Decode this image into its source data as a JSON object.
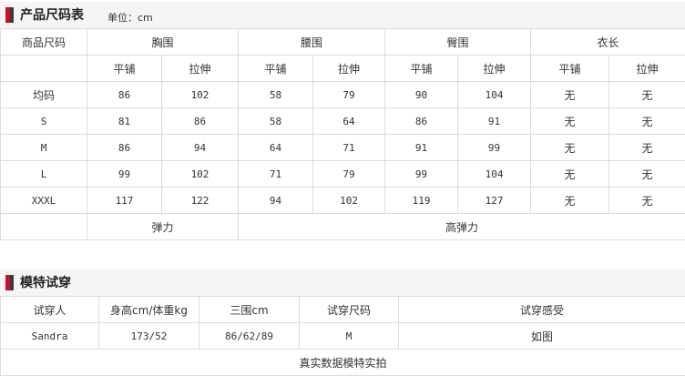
{
  "size_chart": {
    "title": "产品尺码表",
    "unit": "单位：cm",
    "header_main": [
      "商品尺码",
      "胸围",
      "腰围",
      "臀围",
      "衣长"
    ],
    "header_sub": [
      "平铺",
      "拉伸",
      "平铺",
      "拉伸",
      "平铺",
      "拉伸",
      "平铺",
      "拉伸"
    ],
    "rows": [
      {
        "size": "均码",
        "values": [
          "86",
          "102",
          "58",
          "79",
          "90",
          "104",
          "无",
          "无"
        ]
      },
      {
        "size": "S",
        "values": [
          "81",
          "86",
          "58",
          "64",
          "86",
          "91",
          "无",
          "无"
        ]
      },
      {
        "size": "M",
        "values": [
          "86",
          "94",
          "64",
          "71",
          "91",
          "99",
          "无",
          "无"
        ]
      },
      {
        "size": "L",
        "values": [
          "99",
          "102",
          "71",
          "79",
          "99",
          "104",
          "无",
          "无"
        ]
      },
      {
        "size": "XXXL",
        "values": [
          "117",
          "122",
          "94",
          "102",
          "119",
          "127",
          "无",
          "无"
        ]
      }
    ],
    "elasticity": [
      "弹力",
      "高弹力"
    ]
  },
  "model_fit": {
    "title": "模特试穿",
    "headers": [
      "试穿人",
      "身高cm/体重kg",
      "三围cm",
      "试穿尺码",
      "试穿感受"
    ],
    "row": [
      "Sandra",
      "173/52",
      "86/62/89",
      "M",
      "如图"
    ],
    "footer": "真实数据模特实拍"
  }
}
